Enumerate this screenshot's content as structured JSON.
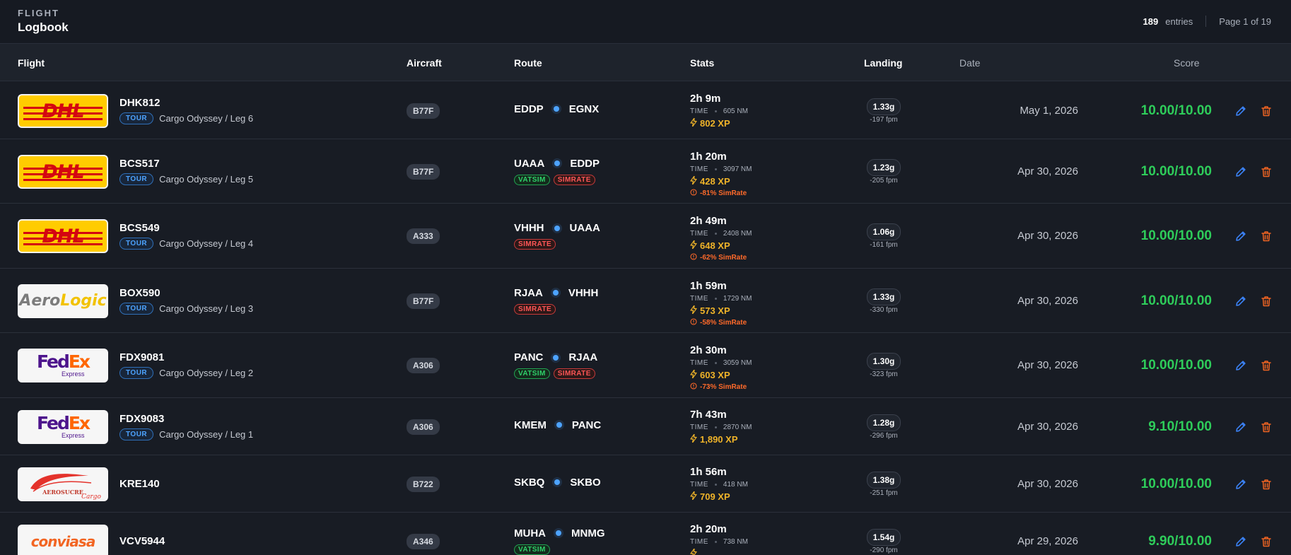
{
  "header": {
    "eyebrow": "FLIGHT",
    "title": "Logbook",
    "entries_count": "189",
    "entries_label": "entries",
    "page_info": "Page 1 of 19"
  },
  "columns": {
    "flight": "Flight",
    "aircraft": "Aircraft",
    "route": "Route",
    "stats": "Stats",
    "landing": "Landing",
    "date": "Date",
    "score": "Score"
  },
  "labels": {
    "time": "TIME",
    "tour": "TOUR"
  },
  "colors": {
    "background": "#181c24",
    "score_green": "#2ecc5a",
    "xp_gold": "#f0b429",
    "simrate_orange": "#ff6a2a",
    "accent_blue": "#4da3ff",
    "delete_orange": "#f26522"
  },
  "icons": {
    "xp": "lightning-icon",
    "simrate": "alert-circle-icon",
    "edit": "pencil-icon",
    "delete": "trash-icon"
  },
  "rows": [
    {
      "airline_logo": "DHL",
      "callsign": "DHK812",
      "tour": "Cargo Odyssey / Leg 6",
      "aircraft": "B77F",
      "origin": "EDDP",
      "destination": "EGNX",
      "tags": [],
      "duration": "2h 9m",
      "distance": "605 NM",
      "xp": "802 XP",
      "simrate": "",
      "landing_g": "1.33g",
      "fpm": "-197 fpm",
      "date": "May 1, 2026",
      "score": "10.00/10.00"
    },
    {
      "airline_logo": "DHL",
      "callsign": "BCS517",
      "tour": "Cargo Odyssey / Leg 5",
      "aircraft": "B77F",
      "origin": "UAAA",
      "destination": "EDDP",
      "tags": [
        "VATSIM",
        "SIMRATE"
      ],
      "duration": "1h 20m",
      "distance": "3097 NM",
      "xp": "428 XP",
      "simrate": "-81% SimRate",
      "landing_g": "1.23g",
      "fpm": "-205 fpm",
      "date": "Apr 30, 2026",
      "score": "10.00/10.00"
    },
    {
      "airline_logo": "DHL",
      "callsign": "BCS549",
      "tour": "Cargo Odyssey / Leg 4",
      "aircraft": "A333",
      "origin": "VHHH",
      "destination": "UAAA",
      "tags": [
        "SIMRATE"
      ],
      "duration": "2h 49m",
      "distance": "2408 NM",
      "xp": "648 XP",
      "simrate": "-62% SimRate",
      "landing_g": "1.06g",
      "fpm": "-161 fpm",
      "date": "Apr 30, 2026",
      "score": "10.00/10.00"
    },
    {
      "airline_logo": "AeroLogic",
      "callsign": "BOX590",
      "tour": "Cargo Odyssey / Leg 3",
      "aircraft": "B77F",
      "origin": "RJAA",
      "destination": "VHHH",
      "tags": [
        "SIMRATE"
      ],
      "duration": "1h 59m",
      "distance": "1729 NM",
      "xp": "573 XP",
      "simrate": "-58% SimRate",
      "landing_g": "1.33g",
      "fpm": "-330 fpm",
      "date": "Apr 30, 2026",
      "score": "10.00/10.00"
    },
    {
      "airline_logo": "FedEx",
      "callsign": "FDX9081",
      "tour": "Cargo Odyssey / Leg 2",
      "aircraft": "A306",
      "origin": "PANC",
      "destination": "RJAA",
      "tags": [
        "VATSIM",
        "SIMRATE"
      ],
      "duration": "2h 30m",
      "distance": "3059 NM",
      "xp": "603 XP",
      "simrate": "-73% SimRate",
      "landing_g": "1.30g",
      "fpm": "-323 fpm",
      "date": "Apr 30, 2026",
      "score": "10.00/10.00"
    },
    {
      "airline_logo": "FedEx",
      "callsign": "FDX9083",
      "tour": "Cargo Odyssey / Leg 1",
      "aircraft": "A306",
      "origin": "KMEM",
      "destination": "PANC",
      "tags": [],
      "duration": "7h 43m",
      "distance": "2870 NM",
      "xp": "1,890 XP",
      "simrate": "",
      "landing_g": "1.28g",
      "fpm": "-296 fpm",
      "date": "Apr 30, 2026",
      "score": "9.10/10.00"
    },
    {
      "airline_logo": "Aerosucre",
      "callsign": "KRE140",
      "tour": "",
      "aircraft": "B722",
      "origin": "SKBQ",
      "destination": "SKBO",
      "tags": [],
      "duration": "1h 56m",
      "distance": "418 NM",
      "xp": "709 XP",
      "simrate": "",
      "landing_g": "1.38g",
      "fpm": "-251 fpm",
      "date": "Apr 30, 2026",
      "score": "10.00/10.00"
    },
    {
      "airline_logo": "Conviasa",
      "callsign": "VCV5944",
      "tour": "",
      "aircraft": "A346",
      "origin": "MUHA",
      "destination": "MNMG",
      "tags": [
        "VATSIM"
      ],
      "duration": "2h 20m",
      "distance": "738 NM",
      "xp": "",
      "simrate": "",
      "landing_g": "1.54g",
      "fpm": "-290 fpm",
      "date": "Apr 29, 2026",
      "score": "9.90/10.00"
    }
  ]
}
